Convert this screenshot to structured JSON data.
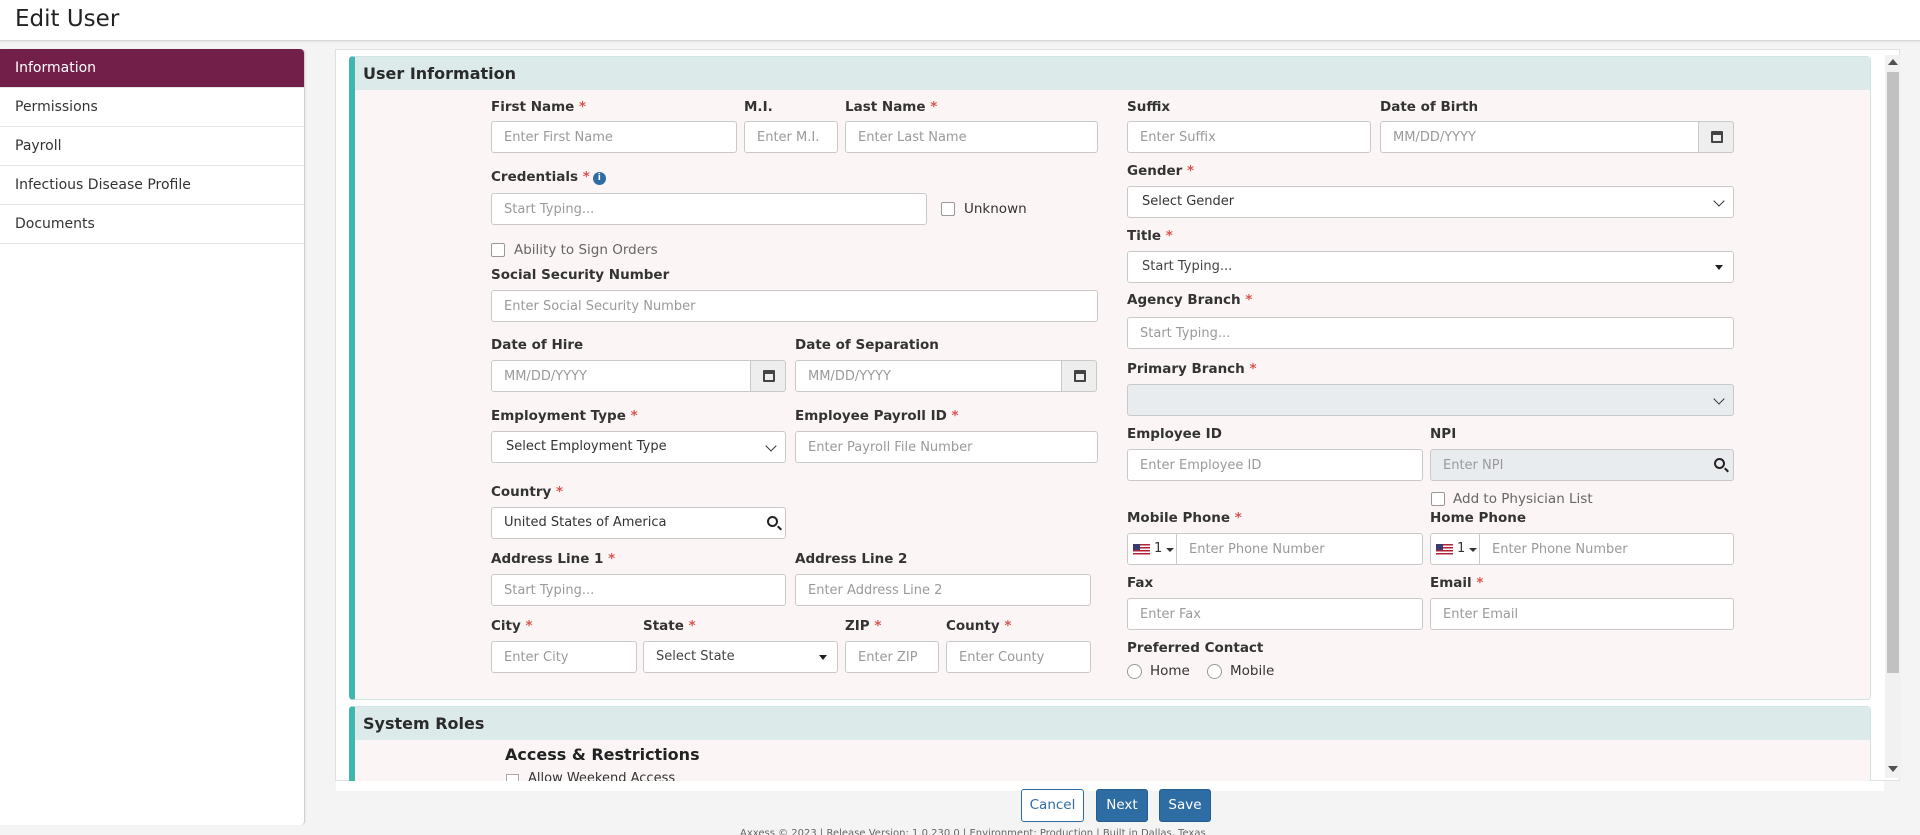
{
  "header": {
    "title": "Edit User"
  },
  "sidebar": {
    "items": [
      {
        "label": "Information"
      },
      {
        "label": "Permissions"
      },
      {
        "label": "Payroll"
      },
      {
        "label": "Infectious Disease Profile"
      },
      {
        "label": "Documents"
      }
    ],
    "active": "Information"
  },
  "user_info": {
    "title": "User Information",
    "required_mark": "*",
    "first_name": {
      "label": "First Name",
      "placeholder": "Enter First Name"
    },
    "mi": {
      "label": "M.I.",
      "placeholder": "Enter M.I."
    },
    "last_name": {
      "label": "Last Name",
      "placeholder": "Enter Last Name"
    },
    "suffix": {
      "label": "Suffix",
      "placeholder": "Enter Suffix"
    },
    "dob": {
      "label": "Date of Birth",
      "placeholder": "MM/DD/YYYY"
    },
    "credentials": {
      "label": "Credentials",
      "placeholder": "Start Typing..."
    },
    "unknown": {
      "label": "Unknown"
    },
    "gender": {
      "label": "Gender",
      "value": "Select Gender"
    },
    "ability_sign": {
      "label": "Ability to Sign Orders"
    },
    "title_field": {
      "label": "Title",
      "placeholder": "Start Typing..."
    },
    "ssn": {
      "label": "Social Security Number",
      "placeholder": "Enter Social Security Number"
    },
    "agency_branch": {
      "label": "Agency Branch",
      "placeholder": "Start Typing..."
    },
    "date_hire": {
      "label": "Date of Hire",
      "placeholder": "MM/DD/YYYY"
    },
    "date_separation": {
      "label": "Date of Separation",
      "placeholder": "MM/DD/YYYY"
    },
    "primary_branch": {
      "label": "Primary Branch",
      "value": ""
    },
    "employment_type": {
      "label": "Employment Type",
      "value": "Select Employment Type"
    },
    "payroll_id": {
      "label": "Employee Payroll ID",
      "placeholder": "Enter Payroll File Number"
    },
    "employee_id": {
      "label": "Employee ID",
      "placeholder": "Enter Employee ID"
    },
    "npi": {
      "label": "NPI",
      "placeholder": "Enter NPI"
    },
    "add_physician": {
      "label": "Add to Physician List"
    },
    "country": {
      "label": "Country",
      "value": "United States of America"
    },
    "mobile_phone": {
      "label": "Mobile Phone",
      "code": "1",
      "placeholder": "Enter Phone Number"
    },
    "home_phone": {
      "label": "Home Phone",
      "code": "1",
      "placeholder": "Enter Phone Number"
    },
    "address1": {
      "label": "Address Line 1",
      "placeholder": "Start Typing..."
    },
    "address2": {
      "label": "Address Line 2",
      "placeholder": "Enter Address Line 2"
    },
    "fax": {
      "label": "Fax",
      "placeholder": "Enter Fax"
    },
    "email": {
      "label": "Email",
      "placeholder": "Enter Email"
    },
    "city": {
      "label": "City",
      "placeholder": "Enter City"
    },
    "state": {
      "label": "State",
      "value": "Select State"
    },
    "zip": {
      "label": "ZIP",
      "placeholder": "Enter ZIP"
    },
    "county": {
      "label": "County",
      "placeholder": "Enter County"
    },
    "preferred_contact": {
      "label": "Preferred Contact",
      "options": [
        "Home",
        "Mobile"
      ]
    }
  },
  "system_roles": {
    "title": "System Roles",
    "access_title": "Access & Restrictions",
    "weekend_label": "Allow Weekend Access"
  },
  "buttons": {
    "cancel": "Cancel",
    "next": "Next",
    "save": "Save"
  },
  "footer": {
    "text": "Axxess © 2023 | Release Version: 1.0.230.0 | Environment: Production | Built in Dallas, Texas"
  },
  "colors": {
    "sidebar_active": "#72204a",
    "panel_accent": "#3fb6ae",
    "panel_header": "#dcebea",
    "primary_button": "#2e6da4",
    "required": "#d9534f"
  }
}
